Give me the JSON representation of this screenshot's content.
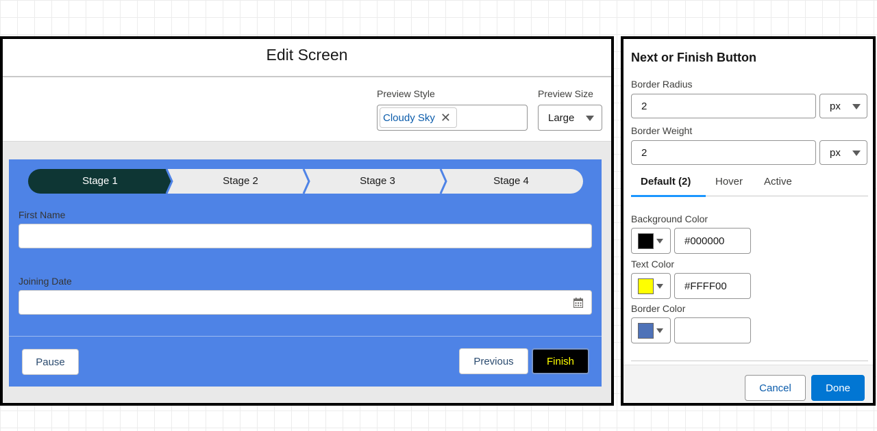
{
  "editor": {
    "title": "Edit Screen",
    "preview_style_label": "Preview Style",
    "preview_style_value": "Cloudy Sky",
    "preview_size_label": "Preview Size",
    "preview_size_value": "Large"
  },
  "path": {
    "stages": [
      "Stage 1",
      "Stage 2",
      "Stage 3",
      "Stage 4"
    ],
    "active_index": 0,
    "active_color": "#0e3634",
    "inactive_color": "#ececec",
    "separator_color": "#4e83e6"
  },
  "form": {
    "fields": [
      {
        "label": "First Name",
        "value": ""
      },
      {
        "label": "Joining Date",
        "value": ""
      }
    ],
    "card_color": "#4e83e6",
    "pause_label": "Pause",
    "previous_label": "Previous",
    "finish_label": "Finish"
  },
  "panel": {
    "title": "Next or Finish Button",
    "border_radius_label": "Border Radius",
    "border_radius_value": "2",
    "border_radius_unit": "px",
    "border_weight_label": "Border Weight",
    "border_weight_value": "2",
    "border_weight_unit": "px",
    "tabs": [
      "Default (2)",
      "Hover",
      "Active"
    ],
    "active_tab": 0,
    "background_color_label": "Background Color",
    "background_color_value": "#000000",
    "background_swatch": "#000000",
    "text_color_label": "Text Color",
    "text_color_value": "#FFFF00",
    "text_swatch": "#ffff00",
    "border_color_label": "Border Color",
    "border_color_value": "",
    "border_swatch": "#4e72b8",
    "cancel_label": "Cancel",
    "done_label": "Done"
  }
}
